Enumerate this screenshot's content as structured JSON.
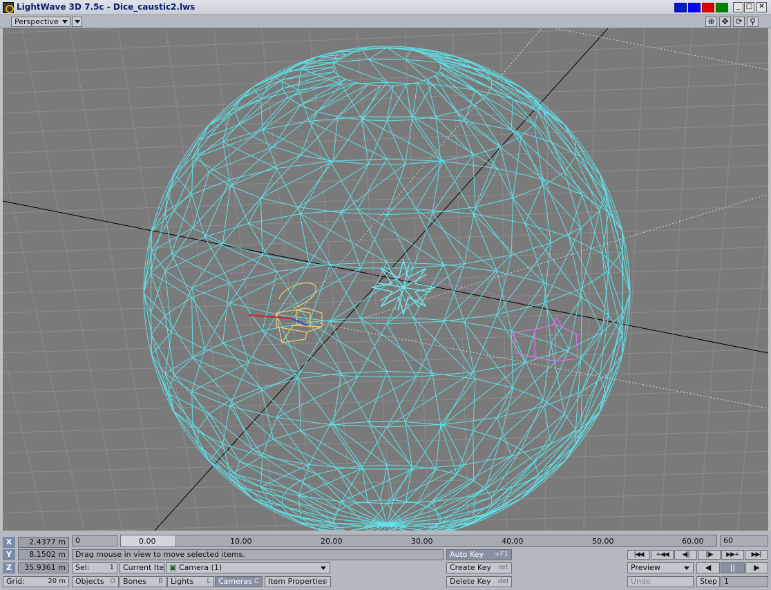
{
  "window": {
    "title": "LightWave 3D 7.5c - Dice_caustic2.lws",
    "controls": {
      "minimize": "_",
      "maximize": "□",
      "close": "✕"
    },
    "swatch_colors": [
      "#0018c0",
      "#0000ff",
      "#d80000",
      "#008000"
    ]
  },
  "viewport": {
    "view_mode": "Perspective",
    "tool_icons": [
      "move-view-icon",
      "pan-view-icon",
      "rotate-view-icon",
      "zoom-view-icon"
    ],
    "tool_glyphs": [
      "⊕",
      "✥",
      "⟳",
      "⚲"
    ],
    "colors": {
      "background": "#7a7a7a",
      "grid": "#8c8c8c",
      "sphere": "#5fe1e8",
      "object": "#6ee6f0",
      "camera": "#e8d070",
      "light": "#e070e8"
    }
  },
  "coords": {
    "x_label": "X",
    "x_value": "2.4377 m",
    "y_label": "Y",
    "y_value": "8.1502 m",
    "z_label": "Z",
    "z_value": "35.9361 m",
    "grid_label": "Grid:",
    "grid_value": "20 m"
  },
  "timeline": {
    "start_frame": "0",
    "end_frame": "60",
    "ticks": [
      "0.00",
      "10.00",
      "20.00",
      "30.00",
      "40.00",
      "50.00",
      "60.00"
    ]
  },
  "status": {
    "message": "Drag mouse in view to move selected items."
  },
  "selection": {
    "sel_label": "Sel:",
    "sel_count": "1",
    "current_item_label": "Current Item",
    "current_item_value": "Camera (1)"
  },
  "item_types": {
    "objects": {
      "label": "Objects",
      "hotkey": "O"
    },
    "bones": {
      "label": "Bones",
      "hotkey": "B"
    },
    "lights": {
      "label": "Lights",
      "hotkey": "L"
    },
    "cameras": {
      "label": "Cameras",
      "hotkey": "C"
    },
    "item_properties": {
      "label": "Item Properties",
      "hotkey": "p"
    }
  },
  "keys": {
    "auto_key": {
      "label": "Auto Key",
      "hotkey": "+F1"
    },
    "create_key": {
      "label": "Create Key",
      "hotkey": "ret"
    },
    "delete_key": {
      "label": "Delete Key",
      "hotkey": "del"
    }
  },
  "transport": {
    "buttons": [
      "|◀◀",
      "+◀◀",
      "◀||",
      "||▶",
      "▶▶+",
      "▶▶|"
    ],
    "play_back": "◀",
    "pause": "||",
    "play_forward": "▶",
    "preview_label": "Preview",
    "undo_label": "Undo",
    "step_label": "Step",
    "step_value": "1"
  }
}
